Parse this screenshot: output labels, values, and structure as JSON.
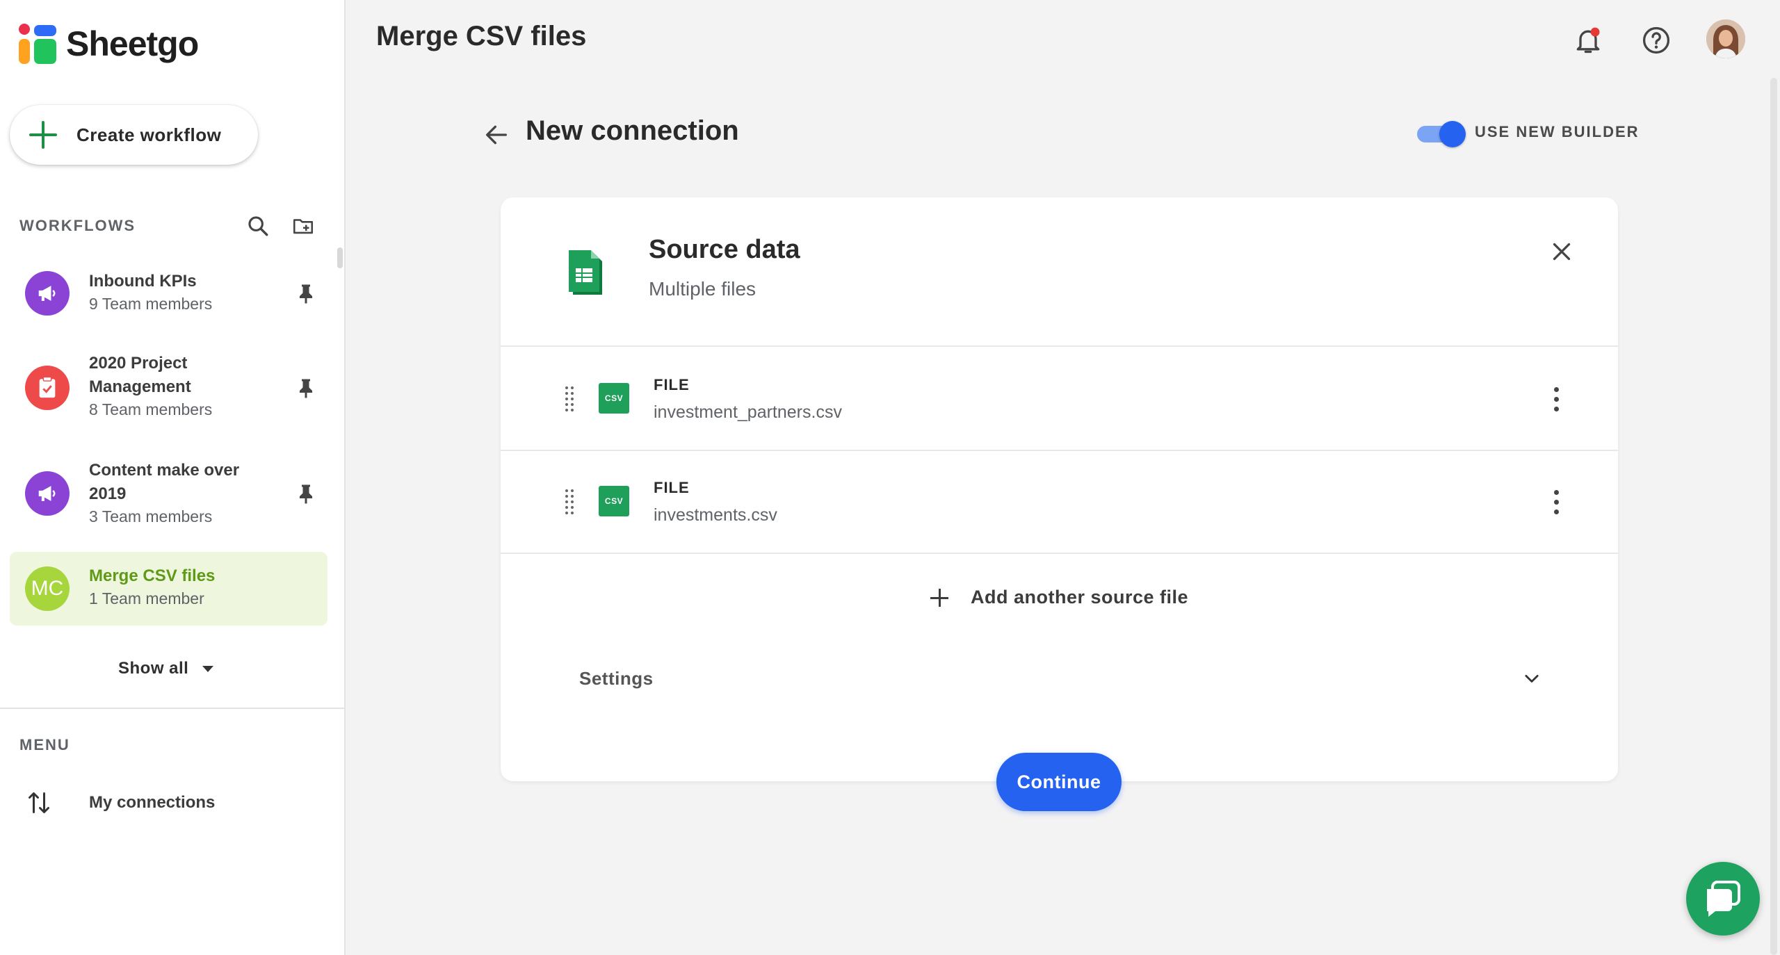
{
  "brand": {
    "name": "Sheetgo"
  },
  "sidebar": {
    "create_label": "Create workflow",
    "workflows_label": "WORKFLOWS",
    "workflows": [
      {
        "title": "Inbound KPIs",
        "members": "9 Team members",
        "color": "#8b43d6",
        "icon": "megaphone-icon"
      },
      {
        "title": "2020 Project Management",
        "members": "8 Team members",
        "color": "#ef4a4a",
        "icon": "clipboard-check-icon"
      },
      {
        "title": "Content make over 2019",
        "members": "3 Team members",
        "color": "#8b43d6",
        "icon": "megaphone-icon"
      },
      {
        "title": "Merge CSV files",
        "members": "1 Team member",
        "color": "#a6d53c",
        "initials": "MC",
        "active": true
      }
    ],
    "show_all_label": "Show all",
    "menu_label": "MENU",
    "menu_items": [
      {
        "label": "My connections",
        "icon": "swap-vertical-icon"
      }
    ]
  },
  "header": {
    "title": "Merge CSV files"
  },
  "connection": {
    "title": "New connection",
    "toggle_label": "USE NEW BUILDER",
    "toggle_on": true
  },
  "source": {
    "title": "Source data",
    "subtitle": "Multiple files",
    "files": [
      {
        "badge": "CSV",
        "type_label": "FILE",
        "name": "investment_partners.csv"
      },
      {
        "badge": "CSV",
        "type_label": "FILE",
        "name": "investments.csv"
      }
    ],
    "add_label": "Add another source file",
    "settings_label": "Settings"
  },
  "actions": {
    "continue_label": "Continue"
  },
  "colors": {
    "accent": "#2562ef",
    "brand_green": "#1da35f",
    "active_bg": "#eef6dd",
    "active_text": "#5f9a16"
  }
}
